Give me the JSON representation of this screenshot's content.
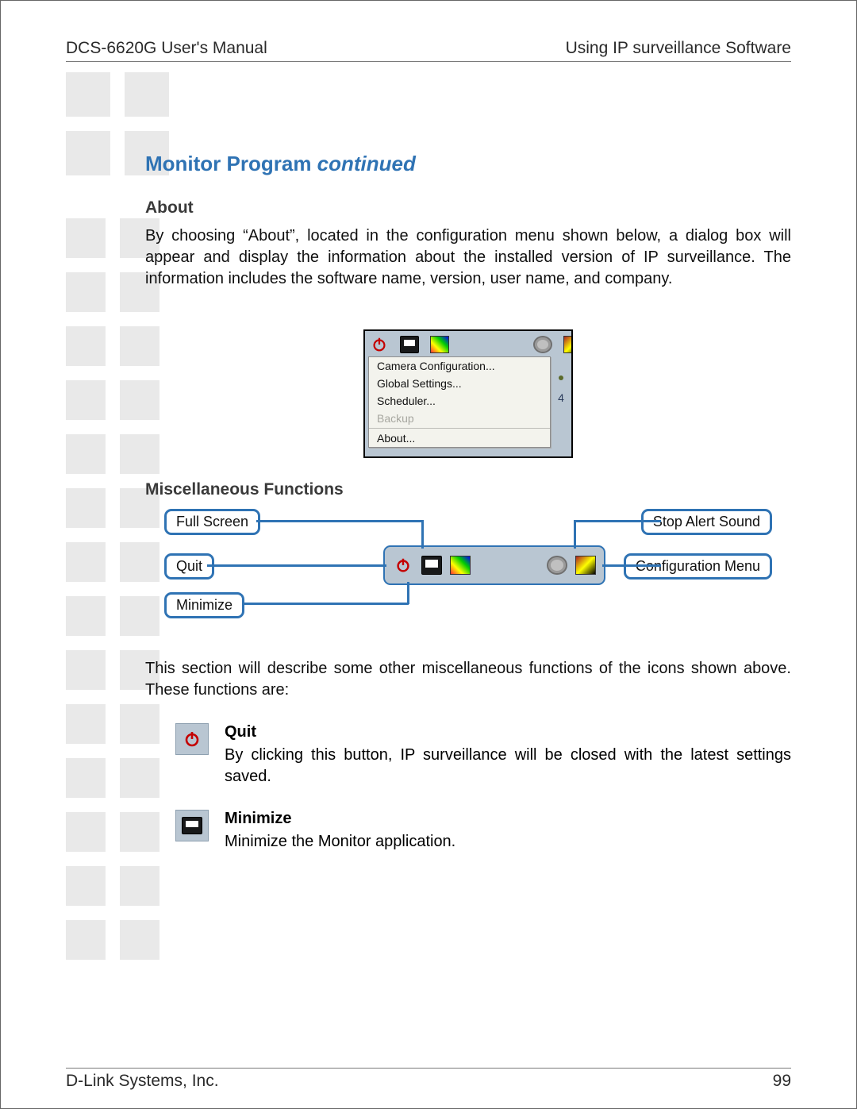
{
  "header": {
    "left": "DCS-6620G User's Manual",
    "right": "Using IP surveillance Software"
  },
  "footer": {
    "left": "D-Link Systems, Inc.",
    "page": "99"
  },
  "title": {
    "main": "Monitor Program ",
    "suffix": "continued"
  },
  "about": {
    "heading": "About",
    "text": "By choosing “About”, located in the configuration menu shown below, a dialog box will appear and display the information about the installed version of IP surveillance. The information includes the software name, version, user name, and company."
  },
  "config_menu": {
    "items": [
      "Camera Configuration...",
      "Global Settings...",
      "Scheduler...",
      "Backup",
      "About..."
    ],
    "disabled_index": 3,
    "side_number": "4"
  },
  "misc": {
    "heading": "Miscellaneous Functions",
    "callouts": {
      "full_screen": "Full Screen",
      "quit": "Quit",
      "minimize": "Minimize",
      "stop_alert": "Stop Alert Sound",
      "config_menu": "Configuration Menu"
    },
    "para": "This section will describe some other miscellaneous functions of the icons shown above. These functions are:"
  },
  "functions": {
    "quit": {
      "title": "Quit",
      "text": "By clicking this button, IP surveillance will be closed with the latest settings saved."
    },
    "minimize": {
      "title": "Minimize",
      "text": "Minimize the Monitor application."
    }
  }
}
